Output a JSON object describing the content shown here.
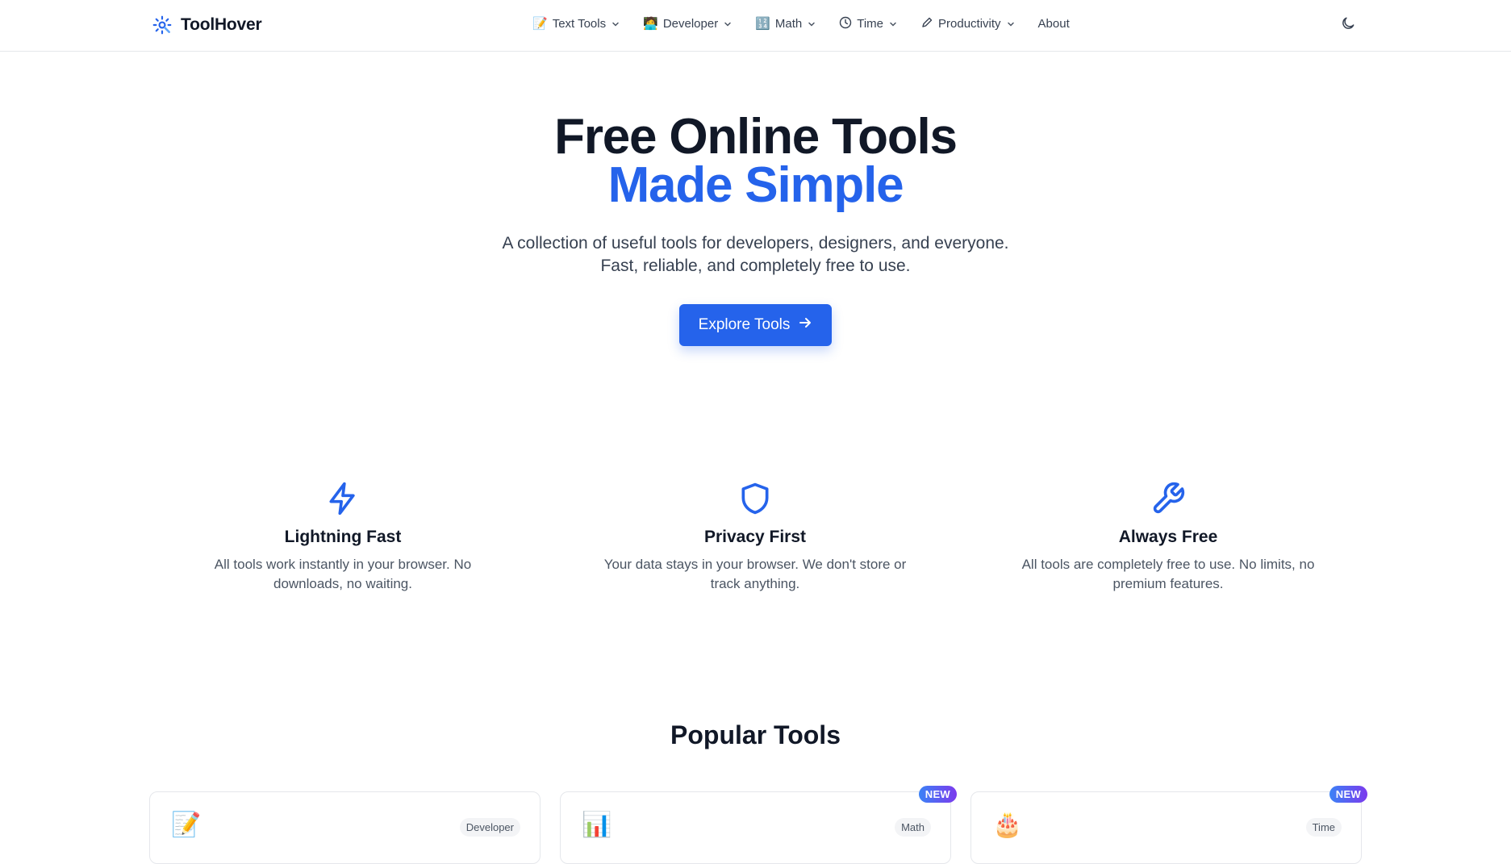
{
  "brand": {
    "name": "ToolHover",
    "icon": "gear-wrench-icon",
    "accent": "#2563eb"
  },
  "nav": {
    "items": [
      {
        "label": "Text Tools",
        "emoji": "📝",
        "icon": "memo-icon",
        "has_dropdown": true
      },
      {
        "label": "Developer",
        "emoji": "🧑‍💻",
        "icon": "developer-icon",
        "has_dropdown": true
      },
      {
        "label": "Math",
        "emoji": "🔢",
        "icon": "numbers-icon",
        "has_dropdown": true
      },
      {
        "label": "Time",
        "emoji": "🕒",
        "icon": "clock-icon",
        "has_dropdown": true
      },
      {
        "label": "Productivity",
        "emoji": "✏️",
        "icon": "pencil-icon",
        "has_dropdown": true
      },
      {
        "label": "About",
        "emoji": "",
        "icon": "",
        "has_dropdown": false
      }
    ],
    "theme_toggle_icon": "moon-icon"
  },
  "hero": {
    "title_line1": "Free Online Tools",
    "title_line2": "Made Simple",
    "subtitle_line1": "A collection of useful tools for developers, designers, and everyone.",
    "subtitle_line2": "Fast, reliable, and completely free to use.",
    "cta_label": "Explore Tools"
  },
  "features": [
    {
      "icon": "lightning-icon",
      "title": "Lightning Fast",
      "desc": "All tools work instantly in your browser. No downloads, no waiting."
    },
    {
      "icon": "shield-icon",
      "title": "Privacy First",
      "desc": "Your data stays in your browser. We don't store or track anything."
    },
    {
      "icon": "wrench-icon",
      "title": "Always Free",
      "desc": "All tools are completely free to use. No limits, no premium features."
    }
  ],
  "popular": {
    "title": "Popular Tools",
    "cards": [
      {
        "emoji": "📝",
        "icon": "memo-icon",
        "tag": "Developer",
        "new": false
      },
      {
        "emoji": "📊",
        "icon": "bar-chart-icon",
        "tag": "Math",
        "new": true,
        "new_label": "NEW"
      },
      {
        "emoji": "🎂",
        "icon": "cake-icon",
        "tag": "Time",
        "new": true,
        "new_label": "NEW"
      }
    ]
  }
}
